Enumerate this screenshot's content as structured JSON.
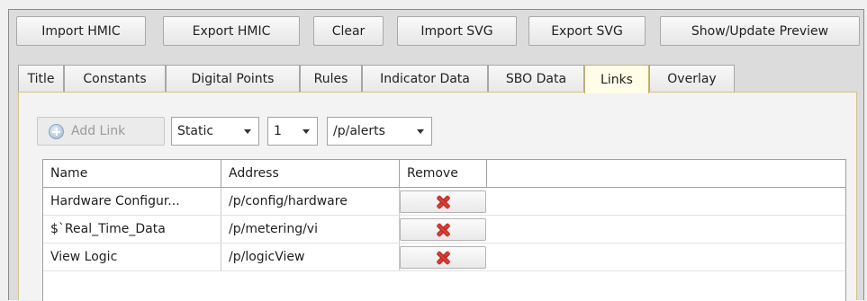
{
  "toolbar": {
    "buttons": [
      {
        "label": "Import HMIC"
      },
      {
        "label": "Export HMIC"
      },
      {
        "label": "Clear"
      },
      {
        "label": "Import SVG"
      },
      {
        "label": "Export SVG"
      },
      {
        "label": "Show/Update Preview"
      }
    ]
  },
  "tabs": [
    {
      "label": "Title"
    },
    {
      "label": "Constants"
    },
    {
      "label": "Digital Points"
    },
    {
      "label": "Rules"
    },
    {
      "label": "Indicator Data"
    },
    {
      "label": "SBO Data"
    },
    {
      "label": "Links",
      "active": true
    },
    {
      "label": "Overlay"
    }
  ],
  "links_panel": {
    "add_link_label": "Add Link",
    "type_select": "Static",
    "index_select": "1",
    "path_select": "/p/alerts",
    "grid": {
      "columns": [
        "Name",
        "Address",
        "Remove"
      ],
      "rows": [
        {
          "name": "Hardware Configur...",
          "address": "/p/config/hardware"
        },
        {
          "name": "$`Real_Time_Data",
          "address": "/p/metering/vi"
        },
        {
          "name": "View Logic",
          "address": "/p/logicView"
        }
      ]
    }
  },
  "colors": {
    "active_tab": "#fffde8",
    "remove_icon": "#d8342b",
    "add_icon": "#9eb6d2"
  },
  "icons": {
    "add": "plus-circle-icon",
    "remove": "red-x-icon",
    "dropdown": "chevron-down-icon"
  }
}
